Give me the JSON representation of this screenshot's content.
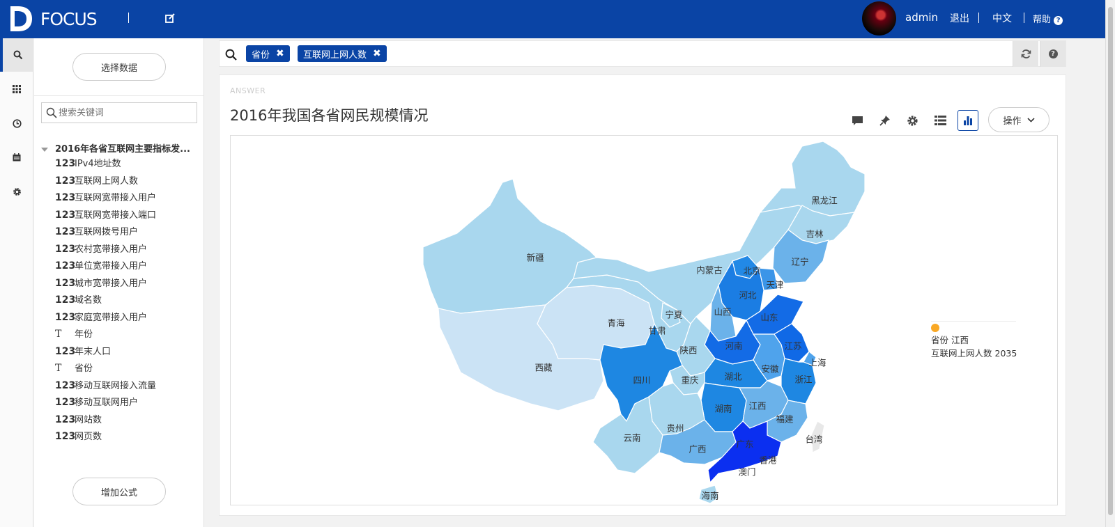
{
  "app": {
    "brand": "FOCUS",
    "user": "admin",
    "logout": "退出",
    "language": "中文",
    "help": "帮助"
  },
  "colors": {
    "brand_blue": "#0a44a5",
    "map_light": "#a9d7ee",
    "map_mid": "#1f8fe0",
    "map_dark": "#0b2ff0",
    "tooltip_dot": "#f9a825"
  },
  "sidebar": {
    "select_data": "选择数据",
    "search_placeholder": "搜索关键词",
    "source": "2016年各省互联网主要指标发...",
    "fields": [
      {
        "type": "123",
        "name": "IPv4地址数"
      },
      {
        "type": "123",
        "name": "互联网上网人数"
      },
      {
        "type": "123",
        "name": "互联网宽带接入用户"
      },
      {
        "type": "123",
        "name": "互联网宽带接入端口"
      },
      {
        "type": "123",
        "name": "互联网拨号用户"
      },
      {
        "type": "123",
        "name": "农村宽带接入用户"
      },
      {
        "type": "123",
        "name": "单位宽带接入用户"
      },
      {
        "type": "123",
        "name": "城市宽带接入用户"
      },
      {
        "type": "123",
        "name": "域名数"
      },
      {
        "type": "123",
        "name": "家庭宽带接入用户"
      },
      {
        "type": "text",
        "name": "年份"
      },
      {
        "type": "123",
        "name": "年末人口"
      },
      {
        "type": "text",
        "name": "省份"
      },
      {
        "type": "123",
        "name": "移动互联网接入流量"
      },
      {
        "type": "123",
        "name": "移动互联网用户"
      },
      {
        "type": "123",
        "name": "网站数"
      },
      {
        "type": "123",
        "name": "网页数"
      }
    ],
    "add_formula": "增加公式"
  },
  "search": {
    "chips": [
      "省份",
      "互联网上网人数"
    ]
  },
  "answer": {
    "label": "ANSWER",
    "title": "2016年我国各省网民规模情况",
    "ops": "操作",
    "tooltip": {
      "province_label": "省份",
      "province": "江西",
      "metric_label": "互联网上网人数",
      "value": "2035"
    }
  },
  "chart_data": {
    "type": "map",
    "region": "China provinces",
    "metric": "互联网上网人数",
    "provinces": [
      "黑龙江",
      "吉林",
      "辽宁",
      "内蒙古",
      "北京",
      "天津",
      "河北",
      "山西",
      "山东",
      "河南",
      "江苏",
      "上海",
      "安徽",
      "浙江",
      "湖北",
      "江西",
      "湖南",
      "福建",
      "广东",
      "香港",
      "澳门",
      "广西",
      "海南",
      "贵州",
      "云南",
      "四川",
      "重庆",
      "陕西",
      "甘肃",
      "宁夏",
      "青海",
      "新疆",
      "西藏",
      "台湾"
    ],
    "values": [
      null,
      null,
      null,
      null,
      null,
      null,
      null,
      null,
      null,
      null,
      null,
      null,
      null,
      null,
      null,
      2035,
      null,
      null,
      null,
      null,
      null,
      null,
      null,
      null,
      null,
      null,
      null,
      null,
      null,
      null,
      null,
      null,
      null,
      null
    ]
  }
}
